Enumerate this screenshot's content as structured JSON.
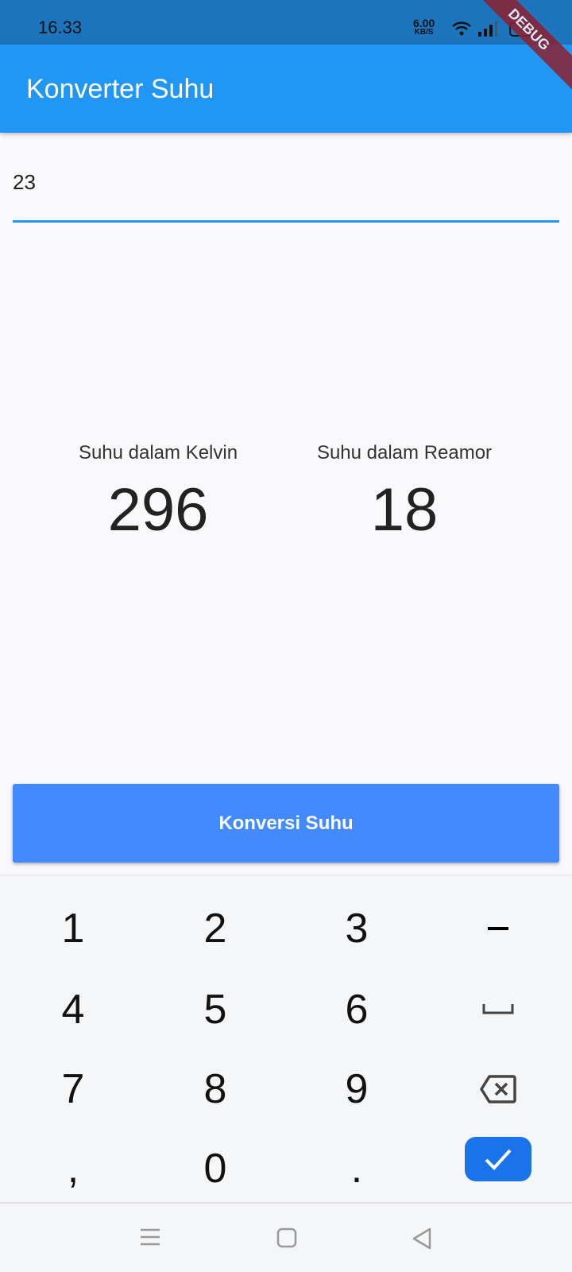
{
  "status": {
    "time": "16.33",
    "speed": "6.00",
    "speed_unit": "KB/S",
    "battery": "58"
  },
  "debug_banner": "DEBUG",
  "appbar": {
    "title": "Konverter Suhu"
  },
  "input": {
    "value": "23"
  },
  "results": [
    {
      "label": "Suhu dalam Kelvin",
      "value": "296"
    },
    {
      "label": "Suhu dalam Reamor",
      "value": "18"
    }
  ],
  "button": {
    "label": "Konversi Suhu"
  },
  "keyboard": {
    "keys": [
      "1",
      "2",
      "3",
      "−",
      "4",
      "5",
      "6",
      "␣",
      "7",
      "8",
      "9",
      "backspace",
      ",",
      "0",
      ".",
      "done"
    ],
    "accent": "#1a73e8"
  },
  "nav": {
    "icons": [
      "menu-icon",
      "home-icon",
      "back-icon"
    ]
  }
}
